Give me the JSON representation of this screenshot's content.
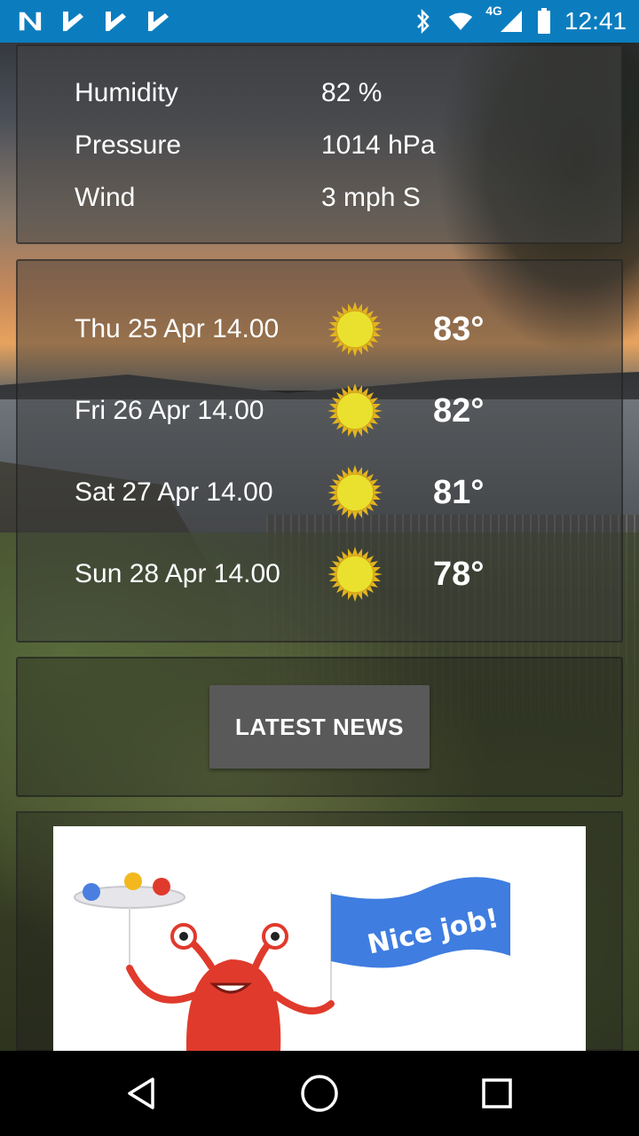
{
  "status_bar": {
    "network_label": "4G",
    "time": "12:41",
    "icons": [
      "n-notification-icon",
      "check-notification-icon",
      "check-notification-icon",
      "check-notification-icon",
      "bluetooth-icon",
      "wifi-icon",
      "cellular-signal-icon",
      "battery-icon"
    ]
  },
  "details": [
    {
      "label": "Humidity",
      "value": "82 %"
    },
    {
      "label": "Pressure",
      "value": "1014 hPa"
    },
    {
      "label": "Wind",
      "value": "3 mph S"
    }
  ],
  "forecast": [
    {
      "date": "Thu 25 Apr 14.00",
      "icon": "sun-icon",
      "temp": "83°"
    },
    {
      "date": "Fri 26 Apr 14.00",
      "icon": "sun-icon",
      "temp": "82°"
    },
    {
      "date": "Sat 27 Apr 14.00",
      "icon": "sun-icon",
      "temp": "81°"
    },
    {
      "date": "Sun 28 Apr 14.00",
      "icon": "sun-icon",
      "temp": "78°"
    }
  ],
  "news_button": {
    "label": "LATEST NEWS"
  },
  "ad": {
    "banner_text": "Nice job!"
  },
  "colors": {
    "status_bar": "#0b7dbf",
    "sun": "#e9e12e",
    "button": "#595959",
    "flag": "#3f7de0",
    "monster": "#e03a2c"
  },
  "nav_bar": [
    "back-icon",
    "home-icon",
    "recents-icon"
  ]
}
